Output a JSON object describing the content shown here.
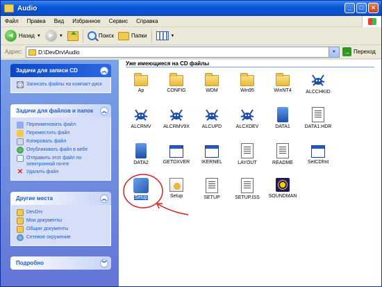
{
  "window": {
    "title": "Audio"
  },
  "menu": [
    "Файл",
    "Правка",
    "Вид",
    "Избранное",
    "Сервис",
    "Справка"
  ],
  "toolbar": {
    "back": "Назад",
    "search": "Поиск",
    "folders": "Папки"
  },
  "address": {
    "label": "Адрес:",
    "value": "D:\\DevDrv\\Audio",
    "go": "Переход"
  },
  "panels": {
    "cd_tasks": {
      "title": "Задачи для записи CD",
      "items": [
        "Записать файлы на компакт-диск"
      ]
    },
    "file_tasks": {
      "title": "Задачи для файлов и папок",
      "items": [
        "Переименовать файл",
        "Переместить файл",
        "Копировать файл",
        "Опубликовать файл в вебе",
        "Отправить этот файл по электронной почте",
        "Удалить файл"
      ]
    },
    "other_places": {
      "title": "Другие места",
      "items": [
        "DevDrv",
        "Мои документы",
        "Общие документы",
        "Сетевое окружение"
      ]
    },
    "details": {
      "title": "Подробно"
    }
  },
  "files": {
    "section_title": "Уже имеющиеся на CD файлы",
    "items": [
      {
        "label": "Ap",
        "icon": "folder-icon"
      },
      {
        "label": "CONFIG",
        "icon": "folder-icon"
      },
      {
        "label": "WDM",
        "icon": "folder-icon"
      },
      {
        "label": "Win95",
        "icon": "folder-icon"
      },
      {
        "label": "WinNT4",
        "icon": "folder-icon"
      },
      {
        "label": "ALCCHKID",
        "icon": "realtek-crab-icon"
      },
      {
        "label": "ALCRMV",
        "icon": "realtek-crab-icon"
      },
      {
        "label": "ALCRMV9X",
        "icon": "realtek-crab-icon"
      },
      {
        "label": "ALCUPD",
        "icon": "realtek-crab-icon"
      },
      {
        "label": "ALCXDEV",
        "icon": "realtek-crab-icon"
      },
      {
        "label": "DATA1",
        "icon": "data-cab-icon"
      },
      {
        "label": "DATA1.HDR",
        "icon": "document-icon"
      },
      {
        "label": "DATA2",
        "icon": "data-cab-icon"
      },
      {
        "label": "GETDXVER",
        "icon": "application-icon"
      },
      {
        "label": "IKERNEL",
        "icon": "application-icon"
      },
      {
        "label": "LAYOUT",
        "icon": "document-icon"
      },
      {
        "label": "README",
        "icon": "document-icon"
      },
      {
        "label": "SetCDfmt",
        "icon": "application-icon"
      },
      {
        "label": "Setup",
        "icon": "setup-installer-icon"
      },
      {
        "label": "Setup",
        "icon": "settings-file-icon"
      },
      {
        "label": "SETUP",
        "icon": "document-icon"
      },
      {
        "label": "SETUP.ISS",
        "icon": "document-icon"
      },
      {
        "label": "SOUNDMAN",
        "icon": "soundman-icon"
      }
    ]
  }
}
